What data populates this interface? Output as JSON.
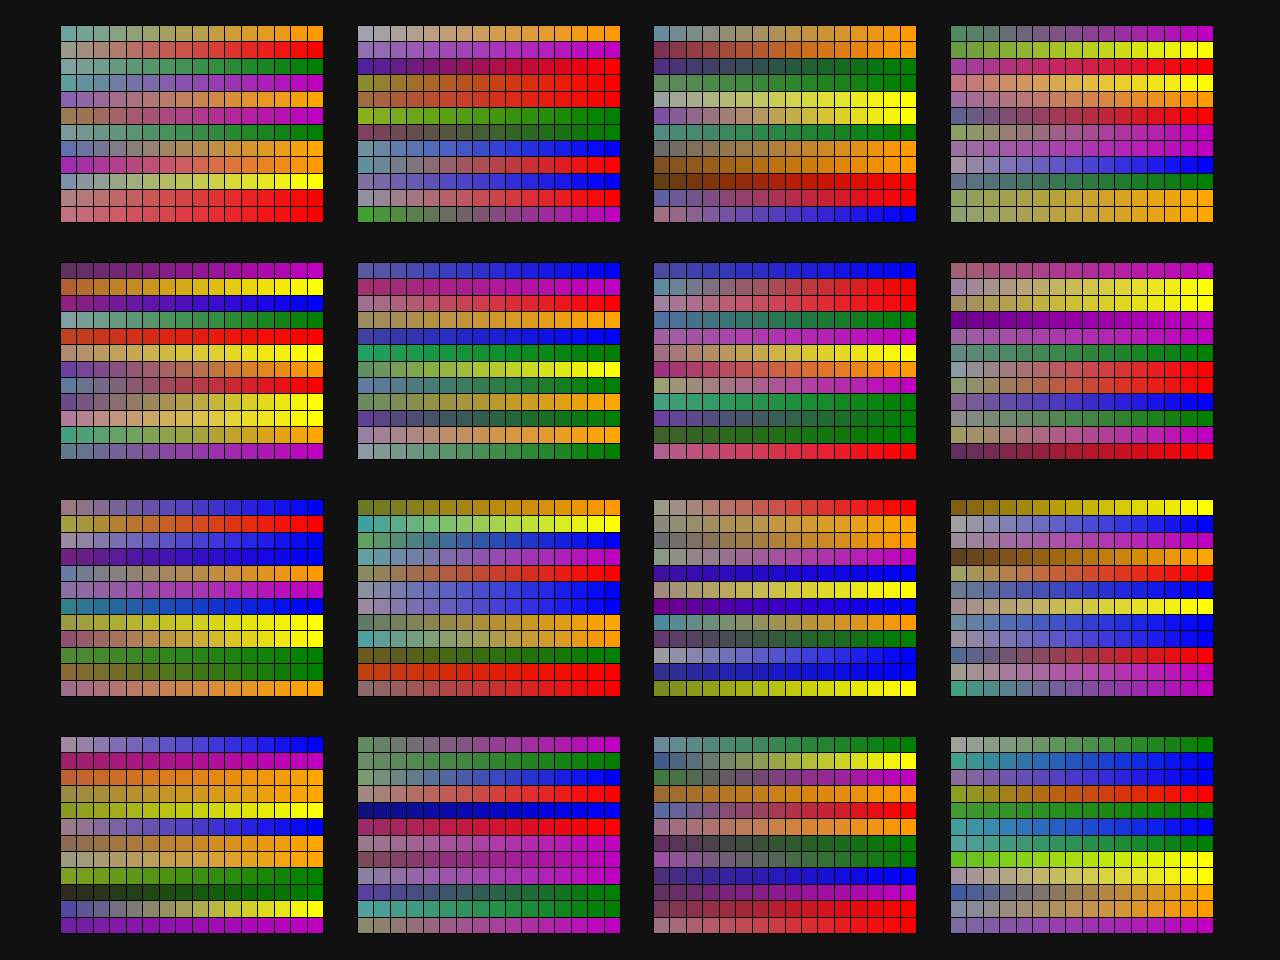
{
  "palette_board": {
    "background": "#111111",
    "cell_outline_color": "#000000",
    "grids_per_row": 4,
    "grids_per_column": 4,
    "cols_per_grid": 16,
    "rows_per_grid": 12,
    "grids": [
      {
        "rows": [
          [
            "#6aa3a0",
            "#ff9900"
          ],
          [
            "#9a9a88",
            "#ff0000"
          ],
          [
            "#80a0a0",
            "#008000"
          ],
          [
            "#5b9c9c",
            "#c000c0"
          ],
          [
            "#8a60b0",
            "#ffa500"
          ],
          [
            "#9a7a50",
            "#c000c0"
          ],
          [
            "#7a9a9a",
            "#008000"
          ],
          [
            "#6070a8",
            "#ffa500"
          ],
          [
            "#a02ab0",
            "#ff9900"
          ],
          [
            "#8090a8",
            "#ffff00"
          ],
          [
            "#b08080",
            "#ff0000"
          ],
          [
            "#c07080",
            "#ff0000"
          ]
        ]
      },
      {
        "rows": [
          [
            "#a0a0b0",
            "#ff9900"
          ],
          [
            "#9070b0",
            "#c000c0"
          ],
          [
            "#5020a0",
            "#ff0000"
          ],
          [
            "#8a8a30",
            "#ff0000"
          ],
          [
            "#a06a40",
            "#ff0000"
          ],
          [
            "#8ab020",
            "#008000"
          ],
          [
            "#804060",
            "#008000"
          ],
          [
            "#7090a0",
            "#0000ff"
          ],
          [
            "#6090a0",
            "#ff0000"
          ],
          [
            "#8070a0",
            "#0000ff"
          ],
          [
            "#9090a0",
            "#ff0000"
          ],
          [
            "#40a030",
            "#c000c0"
          ]
        ]
      },
      {
        "rows": [
          [
            "#6a8aa0",
            "#ff9900"
          ],
          [
            "#803050",
            "#ff9900"
          ],
          [
            "#503080",
            "#008000"
          ],
          [
            "#608a60",
            "#008000"
          ],
          [
            "#9aa0a0",
            "#ffff00"
          ],
          [
            "#8050a0",
            "#ffff00"
          ],
          [
            "#508a80",
            "#008000"
          ],
          [
            "#6a6a6a",
            "#ff9900"
          ],
          [
            "#805020",
            "#ff9900"
          ],
          [
            "#604010",
            "#ff0000"
          ],
          [
            "#6060a0",
            "#ff0000"
          ],
          [
            "#a07080",
            "#0000ff"
          ]
        ]
      },
      {
        "rows": [
          [
            "#508a60",
            "#c000c0"
          ],
          [
            "#6a9a40",
            "#ffff00"
          ],
          [
            "#a040a0",
            "#ff0000"
          ],
          [
            "#c07080",
            "#ffff00"
          ],
          [
            "#a06aa0",
            "#ff9900"
          ],
          [
            "#606090",
            "#ff0000"
          ],
          [
            "#8aa060",
            "#c000c0"
          ],
          [
            "#9a70a0",
            "#c000c0"
          ],
          [
            "#a090a0",
            "#0000ff"
          ],
          [
            "#60708a",
            "#008000"
          ],
          [
            "#8aa060",
            "#ffa500"
          ],
          [
            "#8aa070",
            "#ffa500"
          ]
        ]
      },
      {
        "rows": [
          [
            "#603060",
            "#c000c0"
          ],
          [
            "#b06030",
            "#ffff00"
          ],
          [
            "#902080",
            "#0000ff"
          ],
          [
            "#80a0a0",
            "#008000"
          ],
          [
            "#c04020",
            "#ff0000"
          ],
          [
            "#b08a70",
            "#ffff00"
          ],
          [
            "#6a40a0",
            "#ff9900"
          ],
          [
            "#607a9a",
            "#ff0000"
          ],
          [
            "#6a4a8a",
            "#ffff00"
          ],
          [
            "#b07a9a",
            "#ffff00"
          ],
          [
            "#40a080",
            "#ffa500"
          ],
          [
            "#607a8a",
            "#c000c0"
          ]
        ]
      },
      {
        "rows": [
          [
            "#5a5aa0",
            "#0000ff"
          ],
          [
            "#a03070",
            "#c000c0"
          ],
          [
            "#a07090",
            "#ff0000"
          ],
          [
            "#9a8a60",
            "#ffa500"
          ],
          [
            "#4040a0",
            "#0000ff"
          ],
          [
            "#20a060",
            "#008000"
          ],
          [
            "#609060",
            "#ffff00"
          ],
          [
            "#607aa0",
            "#008000"
          ],
          [
            "#6a8a60",
            "#ffa500"
          ],
          [
            "#604090",
            "#008000"
          ],
          [
            "#9a80a0",
            "#ffa500"
          ],
          [
            "#8a9aa0",
            "#008000"
          ]
        ]
      },
      {
        "rows": [
          [
            "#4a4aa0",
            "#0000ff"
          ],
          [
            "#608aa0",
            "#ff0000"
          ],
          [
            "#a080a0",
            "#ff0000"
          ],
          [
            "#5070a0",
            "#008000"
          ],
          [
            "#a060a0",
            "#c000c0"
          ],
          [
            "#a07080",
            "#ffff00"
          ],
          [
            "#a03080",
            "#ff9900"
          ],
          [
            "#9aa070",
            "#c000c0"
          ],
          [
            "#40a080",
            "#008000"
          ],
          [
            "#6a40a0",
            "#008000"
          ],
          [
            "#40602a",
            "#008000"
          ],
          [
            "#b06090",
            "#ff0000"
          ]
        ]
      },
      {
        "rows": [
          [
            "#a06070",
            "#c000c0"
          ],
          [
            "#9a80a0",
            "#ffff00"
          ],
          [
            "#a08a60",
            "#ffff00"
          ],
          [
            "#700090",
            "#c000c0"
          ],
          [
            "#9a60a0",
            "#c000c0"
          ],
          [
            "#608a80",
            "#008000"
          ],
          [
            "#8a9aa0",
            "#ff0000"
          ],
          [
            "#8a9a70",
            "#ff0000"
          ],
          [
            "#806090",
            "#0000ff"
          ],
          [
            "#8a8a8a",
            "#008000"
          ],
          [
            "#a09a60",
            "#c000c0"
          ],
          [
            "#603060",
            "#ff0000"
          ]
        ]
      },
      {
        "rows": [
          [
            "#9a7a80",
            "#0000ff"
          ],
          [
            "#a0a040",
            "#ff0000"
          ],
          [
            "#9a8aa0",
            "#0000ff"
          ],
          [
            "#702080",
            "#0000ff"
          ],
          [
            "#6a7aa0",
            "#ff9900"
          ],
          [
            "#8a70a0",
            "#c000c0"
          ],
          [
            "#30808a",
            "#0000ff"
          ],
          [
            "#9a9a40",
            "#ffff00"
          ],
          [
            "#905070",
            "#ffff00"
          ],
          [
            "#508a30",
            "#008000"
          ],
          [
            "#8a6a30",
            "#008000"
          ],
          [
            "#a06a8a",
            "#ffa500"
          ]
        ]
      },
      {
        "rows": [
          [
            "#6a7a20",
            "#ff9900"
          ],
          [
            "#40a0a0",
            "#ffff00"
          ],
          [
            "#60a060",
            "#0000ff"
          ],
          [
            "#60a0a0",
            "#c000c0"
          ],
          [
            "#8a8a60",
            "#ff0000"
          ],
          [
            "#8a90a0",
            "#0000ff"
          ],
          [
            "#9a8aa0",
            "#0000ff"
          ],
          [
            "#607a6a",
            "#ffa500"
          ],
          [
            "#50a0a0",
            "#ff9900"
          ],
          [
            "#6a5a20",
            "#008000"
          ],
          [
            "#c04010",
            "#ff0000"
          ],
          [
            "#8a6a6a",
            "#ff0000"
          ]
        ]
      },
      {
        "rows": [
          [
            "#9a9a8a",
            "#ff0000"
          ],
          [
            "#8a8a7a",
            "#ffa500"
          ],
          [
            "#6a6a70",
            "#ff9900"
          ],
          [
            "#8a9a80",
            "#c000c0"
          ],
          [
            "#4010a0",
            "#0000ff"
          ],
          [
            "#a08a80",
            "#ffff00"
          ],
          [
            "#700090",
            "#0000ff"
          ],
          [
            "#4a8a9a",
            "#ff9900"
          ],
          [
            "#603a70",
            "#008000"
          ],
          [
            "#9a9aa0",
            "#0000ff"
          ],
          [
            "#303090",
            "#0000ff"
          ],
          [
            "#7a8a20",
            "#ffff00"
          ]
        ]
      },
      {
        "rows": [
          [
            "#806010",
            "#ffff00"
          ],
          [
            "#a0a0a0",
            "#0000ff"
          ],
          [
            "#9a8a9a",
            "#c000c0"
          ],
          [
            "#604020",
            "#ffa500"
          ],
          [
            "#a0a060",
            "#ff0000"
          ],
          [
            "#6a7a90",
            "#0000ff"
          ],
          [
            "#a08a90",
            "#ffff00"
          ],
          [
            "#6a8aa0",
            "#0000ff"
          ],
          [
            "#9a90a0",
            "#0000ff"
          ],
          [
            "#506a90",
            "#ff0000"
          ],
          [
            "#a09a90",
            "#c000c0"
          ],
          [
            "#40a080",
            "#c000c0"
          ]
        ]
      },
      {
        "rows": [
          [
            "#a08aa0",
            "#0000ff"
          ],
          [
            "#a0206a",
            "#c000c0"
          ],
          [
            "#c06030",
            "#ffa500"
          ],
          [
            "#9a8a40",
            "#ffa500"
          ],
          [
            "#8a9a20",
            "#ffff00"
          ],
          [
            "#9a7a8a",
            "#0000ff"
          ],
          [
            "#8a6a50",
            "#ffa500"
          ],
          [
            "#9a9a80",
            "#ffa500"
          ],
          [
            "#80a020",
            "#008000"
          ],
          [
            "#302a20",
            "#008000"
          ],
          [
            "#504aa0",
            "#ffff00"
          ],
          [
            "#7020a0",
            "#c000c0"
          ]
        ]
      },
      {
        "rows": [
          [
            "#608a60",
            "#c000c0"
          ],
          [
            "#6a8a6a",
            "#008000"
          ],
          [
            "#7a9a70",
            "#0000ff"
          ],
          [
            "#a08a80",
            "#ff0000"
          ],
          [
            "#101080",
            "#0000ff"
          ],
          [
            "#9a2a6a",
            "#ff0000"
          ],
          [
            "#9a7a8a",
            "#c000c0"
          ],
          [
            "#7a4a5a",
            "#c000c0"
          ],
          [
            "#8a80a0",
            "#c000c0"
          ],
          [
            "#5a40a0",
            "#008000"
          ],
          [
            "#50a0a0",
            "#008000"
          ],
          [
            "#8a8a6a",
            "#c000c0"
          ]
        ]
      },
      {
        "rows": [
          [
            "#6a8a9a",
            "#008000"
          ],
          [
            "#405a8a",
            "#ffff00"
          ],
          [
            "#407a40",
            "#c000c0"
          ],
          [
            "#9a6a30",
            "#ff9900"
          ],
          [
            "#5a6aa0",
            "#ff0000"
          ],
          [
            "#9a6a8a",
            "#ff9900"
          ],
          [
            "#603060",
            "#008000"
          ],
          [
            "#9a50a0",
            "#008000"
          ],
          [
            "#4a307a",
            "#0000ff"
          ],
          [
            "#603060",
            "#c000c0"
          ],
          [
            "#7a3a5a",
            "#ff0000"
          ],
          [
            "#a07080",
            "#ff0000"
          ]
        ]
      },
      {
        "rows": [
          [
            "#a0a09a",
            "#008000"
          ],
          [
            "#40a08a",
            "#0000ff"
          ],
          [
            "#8a6a9a",
            "#0000ff"
          ],
          [
            "#8aa020",
            "#ff0000"
          ],
          [
            "#409a30",
            "#008000"
          ],
          [
            "#40a0a0",
            "#0000ff"
          ],
          [
            "#50a0a0",
            "#008000"
          ],
          [
            "#60c020",
            "#ffff00"
          ],
          [
            "#a090a0",
            "#ffff00"
          ],
          [
            "#405aa0",
            "#ffa500"
          ],
          [
            "#808aa0",
            "#ff9900"
          ],
          [
            "#7a6aa0",
            "#c000c0"
          ]
        ]
      }
    ]
  }
}
